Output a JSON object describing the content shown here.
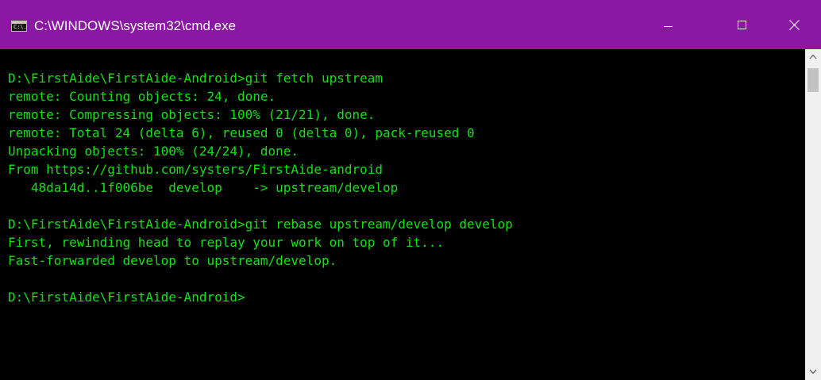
{
  "window": {
    "title": "C:\\WINDOWS\\system32\\cmd.exe",
    "icon": "cmd-icon",
    "icon_label": "C:\\.",
    "titlebar_color": "#8a18a2"
  },
  "controls": {
    "minimize_icon": "minimize-icon",
    "maximize_icon": "maximize-icon",
    "close_icon": "close-icon"
  },
  "console": {
    "text_color": "#13e013",
    "background": "#000000",
    "lines": [
      "D:\\FirstAide\\FirstAide-Android>git fetch upstream",
      "remote: Counting objects: 24, done.",
      "remote: Compressing objects: 100% (21/21), done.",
      "remote: Total 24 (delta 6), reused 0 (delta 0), pack-reused 0",
      "Unpacking objects: 100% (24/24), done.",
      "From https://github.com/systers/FirstAide-android",
      "   48da14d..1f006be  develop    -> upstream/develop",
      "",
      "D:\\FirstAide\\FirstAide-Android>git rebase upstream/develop develop",
      "First, rewinding head to replay your work on top of it...",
      "Fast-forwarded develop to upstream/develop.",
      "",
      "D:\\FirstAide\\FirstAide-Android>"
    ]
  },
  "scrollbar": {
    "up_icon": "chevron-up-icon",
    "down_icon": "chevron-down-icon"
  }
}
